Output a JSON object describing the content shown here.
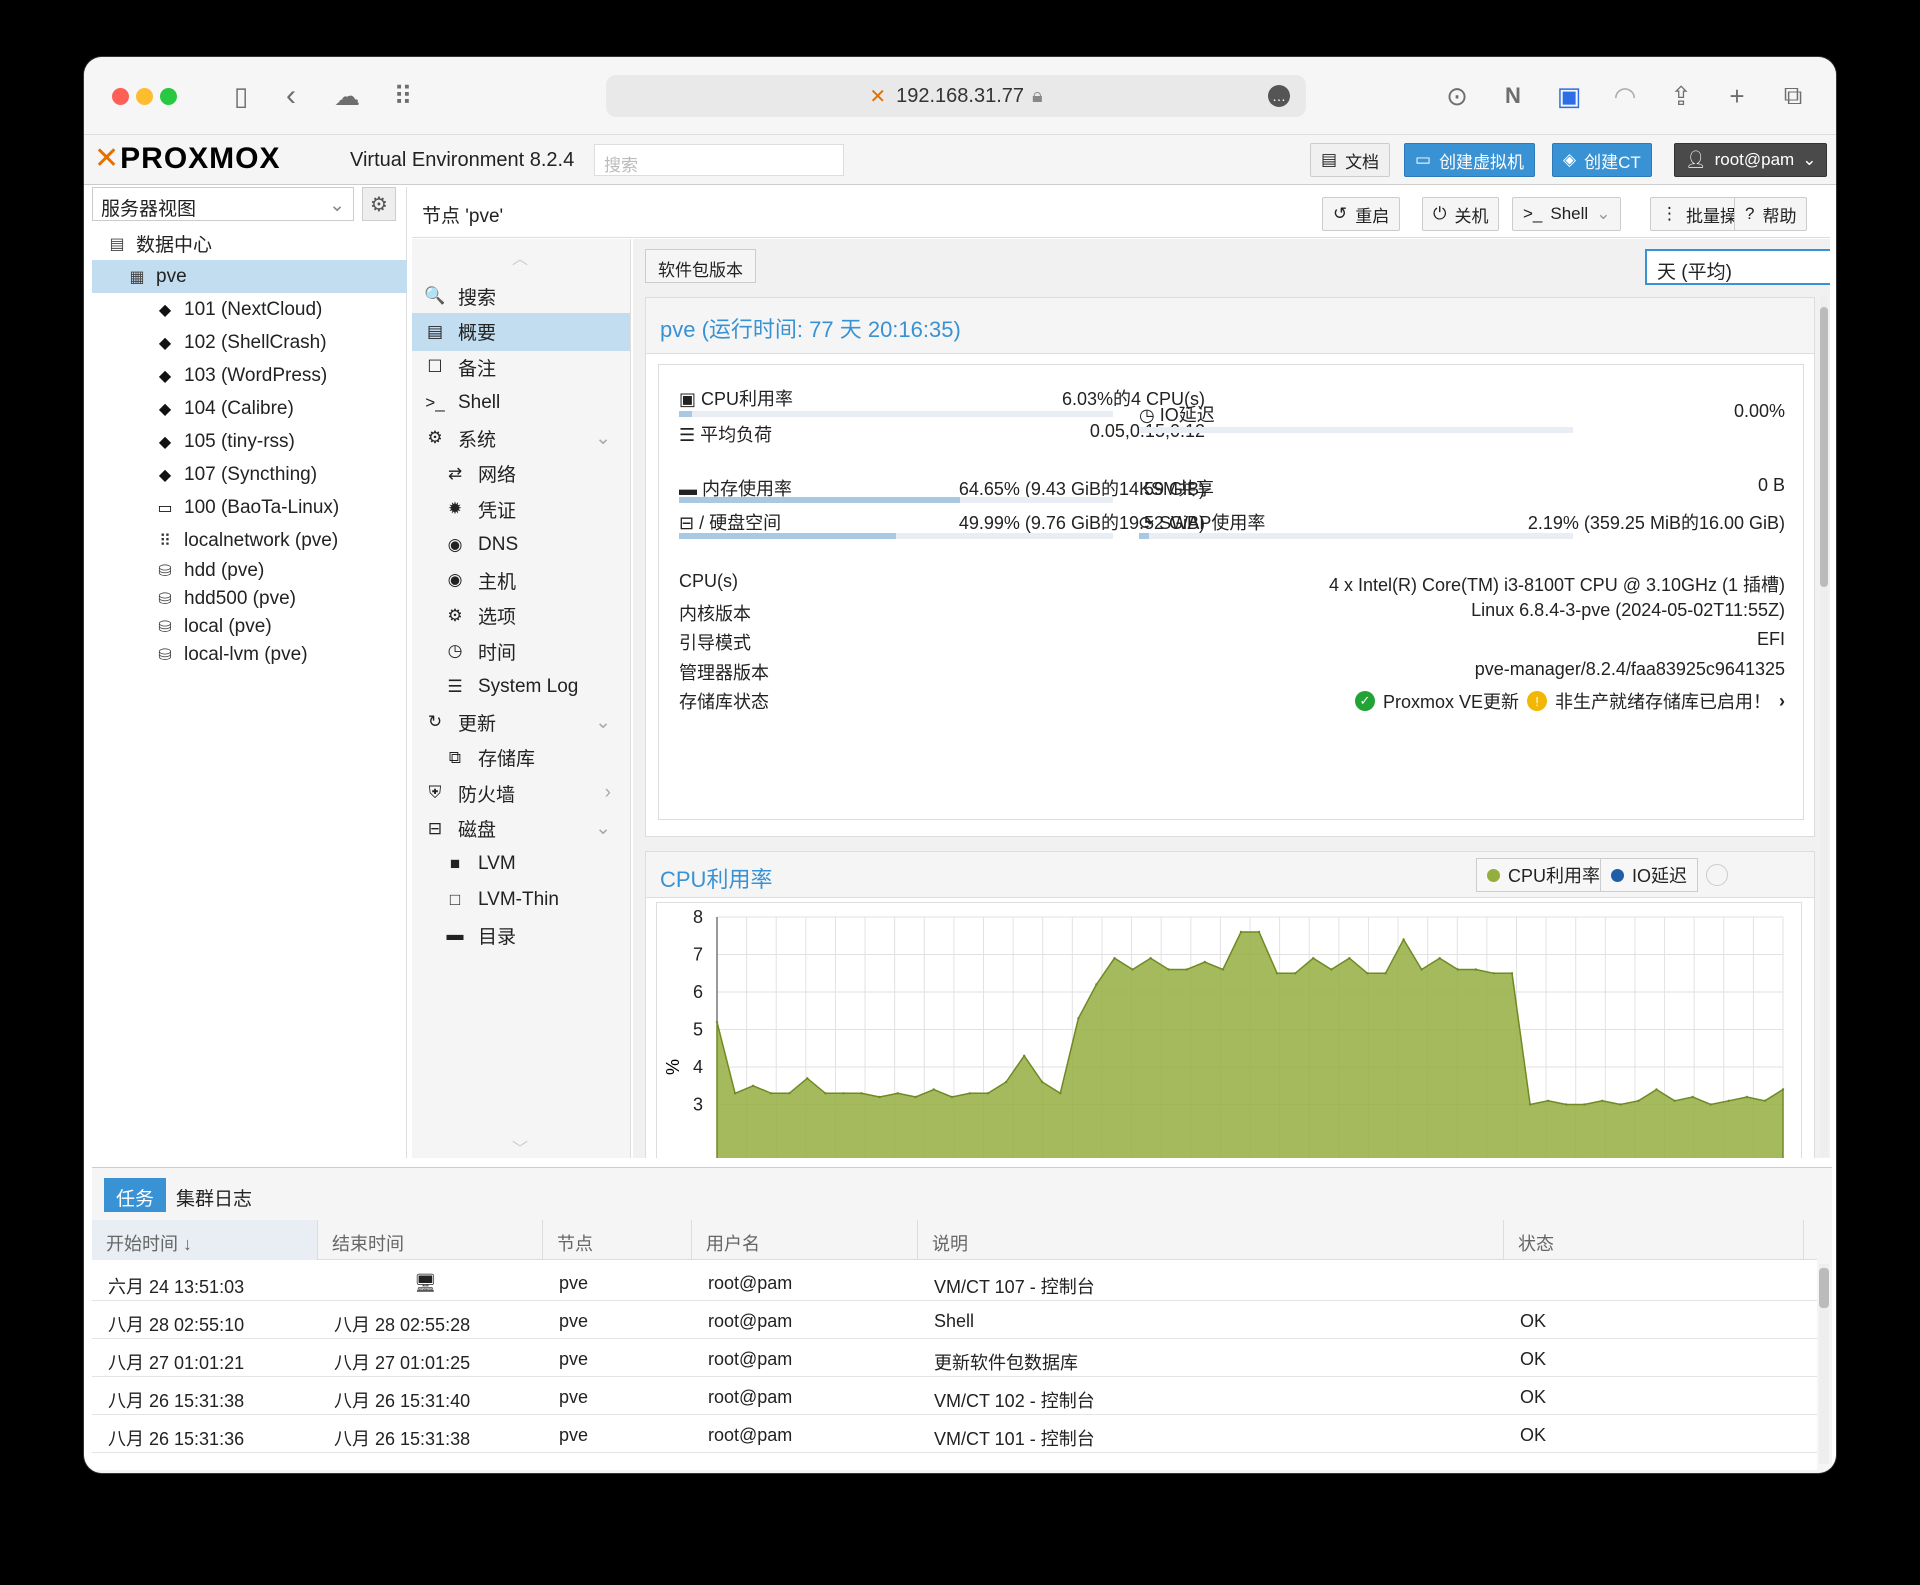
{
  "browser": {
    "url": "192.168.31.77"
  },
  "header": {
    "logo": "PROXMOX",
    "version": "Virtual Environment 8.2.4",
    "search_placeholder": "搜索",
    "docs": "文档",
    "create_vm": "创建虚拟机",
    "create_ct": "创建CT",
    "user": "root@pam"
  },
  "sidebar": {
    "view": "服务器视图",
    "tree": [
      {
        "label": "数据中心",
        "kind": "datacenter"
      },
      {
        "label": "pve",
        "kind": "node"
      },
      {
        "label": "101 (NextCloud)",
        "kind": "ct"
      },
      {
        "label": "102 (ShellCrash)",
        "kind": "ct"
      },
      {
        "label": "103 (WordPress)",
        "kind": "ct"
      },
      {
        "label": "104 (Calibre)",
        "kind": "ct"
      },
      {
        "label": "105 (tiny-rss)",
        "kind": "ct"
      },
      {
        "label": "107 (Syncthing)",
        "kind": "ct"
      },
      {
        "label": "100 (BaoTa-Linux)",
        "kind": "vm"
      },
      {
        "label": "localnetwork (pve)",
        "kind": "net"
      },
      {
        "label": "hdd (pve)",
        "kind": "storage"
      },
      {
        "label": "hdd500 (pve)",
        "kind": "storage"
      },
      {
        "label": "local (pve)",
        "kind": "storage"
      },
      {
        "label": "local-lvm (pve)",
        "kind": "storage"
      }
    ]
  },
  "nav": {
    "title": "节点 'pve'",
    "reboot": "重启",
    "shutdown": "关机",
    "shell": "Shell",
    "bulk": "批量操作",
    "help": "帮助"
  },
  "menu": [
    {
      "label": "搜索",
      "icon": "🔍"
    },
    {
      "label": "概要",
      "icon": "▤"
    },
    {
      "label": "备注",
      "icon": "☐"
    },
    {
      "label": "Shell",
      "icon": ">_"
    },
    {
      "label": "系统",
      "icon": "⚙"
    },
    {
      "label": "网络",
      "icon": "⇄"
    },
    {
      "label": "凭证",
      "icon": "✹"
    },
    {
      "label": "DNS",
      "icon": "◉"
    },
    {
      "label": "主机",
      "icon": "◉"
    },
    {
      "label": "选项",
      "icon": "⚙"
    },
    {
      "label": "时间",
      "icon": "◷"
    },
    {
      "label": "System Log",
      "icon": "☰"
    },
    {
      "label": "更新",
      "icon": "↻"
    },
    {
      "label": "存储库",
      "icon": "⧉"
    },
    {
      "label": "防火墙",
      "icon": "⛨"
    },
    {
      "label": "磁盘",
      "icon": "⊟"
    },
    {
      "label": "LVM",
      "icon": "■"
    },
    {
      "label": "LVM-Thin",
      "icon": "□"
    },
    {
      "label": "目录",
      "icon": "▬"
    }
  ],
  "summary": {
    "pkg_button": "软件包版本",
    "timeframe": "天 (平均)",
    "title": "pve (运行时间: 77 天 20:16:35)",
    "cpu_label": "CPU利用率",
    "cpu_value": "6.03%的4 CPU(s)",
    "cpu_pct": 0.03,
    "load_label": "平均负荷",
    "load_value": "0.05,0.15,0.12",
    "io_label": "IO延迟",
    "io_value": "0.00%",
    "mem_label": "内存使用率",
    "mem_value": "64.65% (9.43 GiB的14.59 GiB)",
    "mem_pct": 0.6465,
    "ksm_label": "KSM共享",
    "ksm_value": "0 B",
    "disk_label": "/ 硬盘空间",
    "disk_value": "49.99% (9.76 GiB的19.52 GiB)",
    "disk_pct": 0.4999,
    "swap_label": "SWAP使用率",
    "swap_value": "2.19% (359.25 MiB的16.00 GiB)",
    "swap_pct": 0.0219,
    "cpus_label": "CPU(s)",
    "cpus_value": "4 x Intel(R) Core(TM) i3-8100T CPU @ 3.10GHz (1 插槽)",
    "kernel_label": "内核版本",
    "kernel_value": "Linux 6.8.4-3-pve (2024-05-02T11:55Z)",
    "boot_label": "引导模式",
    "boot_value": "EFI",
    "mgr_label": "管理器版本",
    "mgr_value": "pve-manager/8.2.4/faa83925c9641325",
    "repo_label": "存储库状态",
    "repo_ok": "Proxmox VE更新",
    "repo_warn": "非生产就绪存储库已启用！"
  },
  "cpu_chart": {
    "title": "CPU利用率",
    "legend_cpu": "CPU利用率",
    "legend_io": "IO延迟",
    "colors": {
      "cpu": "#94ae3f",
      "io": "#1f5fa8"
    }
  },
  "chart_data": {
    "type": "area",
    "title": "CPU利用率",
    "ylabel": "%",
    "ylim": [
      3,
      8
    ],
    "yticks": [
      8,
      7,
      6,
      5,
      4,
      3
    ],
    "series": [
      {
        "name": "CPU利用率",
        "values": [
          5.2,
          3.3,
          3.5,
          3.3,
          3.3,
          3.7,
          3.3,
          3.3,
          3.3,
          3.2,
          3.3,
          3.2,
          3.4,
          3.2,
          3.3,
          3.3,
          3.6,
          4.3,
          3.6,
          3.3,
          5.3,
          6.2,
          6.9,
          6.6,
          6.9,
          6.6,
          6.6,
          6.8,
          6.6,
          7.6,
          7.6,
          6.5,
          6.5,
          6.9,
          6.6,
          6.9,
          6.5,
          6.5,
          7.4,
          6.6,
          6.9,
          6.6,
          6.6,
          6.5,
          6.5,
          3.0,
          3.1,
          3.0,
          3.0,
          3.1,
          3.0,
          3.1,
          3.4,
          3.1,
          3.2,
          3.0,
          3.1,
          3.2,
          3.1,
          3.4
        ]
      },
      {
        "name": "IO延迟",
        "values": []
      }
    ]
  },
  "tasks": {
    "tab_tasks": "任务",
    "tab_cluster": "集群日志",
    "columns": [
      "开始时间 ↓",
      "结束时间",
      "节点",
      "用户名",
      "说明",
      "状态"
    ],
    "rows": [
      [
        "六月 24 13:51:03",
        "",
        "pve",
        "root@pam",
        "VM/CT 107 - 控制台",
        ""
      ],
      [
        "八月 28 02:55:10",
        "八月 28 02:55:28",
        "pve",
        "root@pam",
        "Shell",
        "OK"
      ],
      [
        "八月 27 01:01:21",
        "八月 27 01:01:25",
        "pve",
        "root@pam",
        "更新软件包数据库",
        "OK"
      ],
      [
        "八月 26 15:31:38",
        "八月 26 15:31:40",
        "pve",
        "root@pam",
        "VM/CT 102 - 控制台",
        "OK"
      ],
      [
        "八月 26 15:31:36",
        "八月 26 15:31:38",
        "pve",
        "root@pam",
        "VM/CT 101 - 控制台",
        "OK"
      ]
    ]
  }
}
